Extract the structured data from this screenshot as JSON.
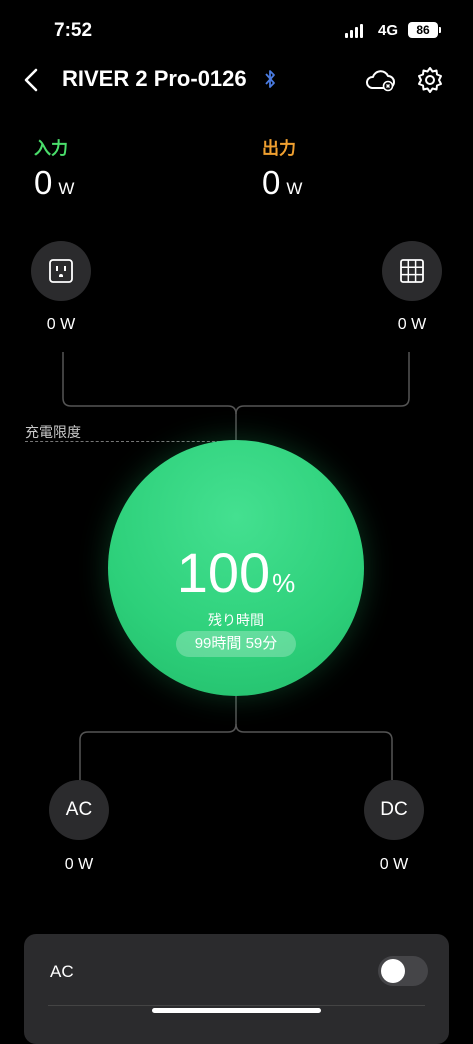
{
  "status_bar": {
    "time": "7:52",
    "network": "4G",
    "battery": "86"
  },
  "header": {
    "title": "RIVER 2 Pro-0126",
    "icons": [
      "back-icon",
      "bluetooth-icon",
      "cloud-icon",
      "gear-icon"
    ]
  },
  "io": {
    "input": {
      "label": "入力",
      "value": "0",
      "unit": "W",
      "color": "#4ade6b"
    },
    "output": {
      "label": "出力",
      "value": "0",
      "unit": "W",
      "color": "#f0a030"
    }
  },
  "sources": {
    "left": {
      "icon": "ac-outlet-icon",
      "value": "0 W"
    },
    "right": {
      "icon": "solar-panel-icon",
      "value": "0 W"
    }
  },
  "charge_limit_label": "充電限度",
  "battery": {
    "percent": "100",
    "percent_sign": "%",
    "remaining_label": "残り時間",
    "remaining": "99時間 59分",
    "color": "#2dd07a"
  },
  "outputs": {
    "ac": {
      "label": "AC",
      "value": "0 W"
    },
    "dc": {
      "label": "DC",
      "value": "0 W"
    }
  },
  "card": {
    "ac_label": "AC",
    "ac_toggle_on": false
  }
}
